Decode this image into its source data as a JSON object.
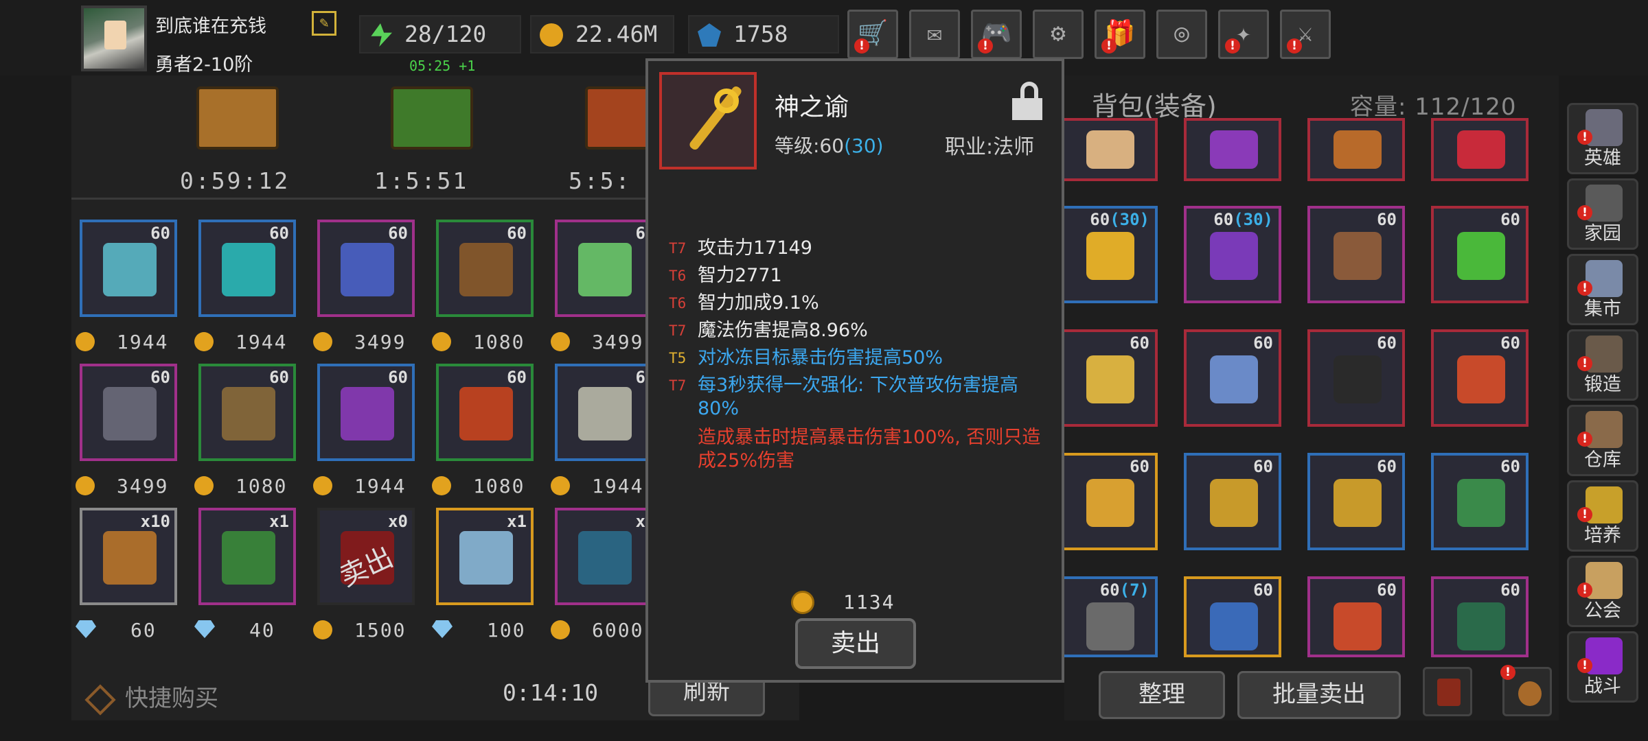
{
  "player": {
    "name": "到底谁在充钱",
    "rank": "勇者2-10阶"
  },
  "resources": {
    "energy": "28/120",
    "energy_timer": "05:25 +1",
    "gold": "22.46M",
    "gems": "1758"
  },
  "top_icons": [
    "shop-cart-icon",
    "mail-icon",
    "gamepad-icon",
    "settings-gear-icon",
    "gift-icon",
    "aperture-wheel-icon",
    "fireworks-icon",
    "crossed-swords-icon"
  ],
  "chests": [
    {
      "time": "0:59:12",
      "color": "#a8702a"
    },
    {
      "time": "1:5:51",
      "color": "#3f7a2a"
    },
    {
      "time": "5:5:",
      "color": "#a4441e"
    }
  ],
  "shop": {
    "row1": [
      {
        "level": "60",
        "price": "1944",
        "border": "#2f6fb8",
        "art": "#5ab8c8"
      },
      {
        "level": "60",
        "price": "1944",
        "border": "#2f6fb8",
        "art": "#2ab8b8"
      },
      {
        "level": "60",
        "price": "3499",
        "border": "#a0308a",
        "art": "#4a62c8"
      },
      {
        "level": "60",
        "price": "1080",
        "border": "#2a8a3a",
        "art": "#8a5a2a"
      },
      {
        "level": "6",
        "price": "3499",
        "border": "#a0308a",
        "art": "#6ac86a"
      }
    ],
    "row2": [
      {
        "level": "60",
        "price": "3499",
        "border": "#a0308a",
        "art": "#6a6a7a"
      },
      {
        "level": "60",
        "price": "1080",
        "border": "#2a8a3a",
        "art": "#8a6a3a"
      },
      {
        "level": "60",
        "price": "1944",
        "border": "#2f6fb8",
        "art": "#8a3ab8"
      },
      {
        "level": "60",
        "price": "1080",
        "border": "#2a8a3a",
        "art": "#c8441e"
      },
      {
        "level": "6",
        "price": "1944",
        "border": "#2f6fb8",
        "art": "#b8b8a8"
      }
    ],
    "row3": [
      {
        "level": "x10",
        "price": "60",
        "border": "#8a8a8a",
        "art": "#b8742a",
        "cur": "gem"
      },
      {
        "level": "x1",
        "price": "40",
        "border": "#a0308a",
        "art": "#3a8a3a",
        "cur": "gem"
      },
      {
        "level": "x0",
        "price": "1500",
        "border": "#2a2a2a",
        "art": "#8a1a1a",
        "cur": "gold",
        "sold": "卖出"
      },
      {
        "level": "x1",
        "price": "100",
        "border": "#d89a1e",
        "art": "#8ab8d8",
        "cur": "gem"
      },
      {
        "level": "x",
        "price": "6000",
        "border": "#a0308a",
        "art": "#2a6a8a",
        "cur": "gold"
      }
    ]
  },
  "left_bottom": {
    "quick_buy": "快捷购买",
    "timer": "0:14:10",
    "refresh": "刷新"
  },
  "bag": {
    "title": "背包(装备)",
    "capacity": "容量: 112/120",
    "sort": "整理",
    "bulk_sell": "批量卖出"
  },
  "bag_rows": [
    [
      {
        "lvl": "",
        "lvl2": "",
        "border": "#a82a3a",
        "art": "#d8b080"
      },
      {
        "lvl": "",
        "lvl2": "",
        "border": "#a82a3a",
        "art": "#8a3ab8"
      },
      {
        "lvl": "",
        "lvl2": "",
        "border": "#a82a3a",
        "art": "#b86a2a"
      },
      {
        "lvl": "",
        "lvl2": "",
        "border": "#a82a3a",
        "art": "#c82a3a"
      }
    ],
    [
      {
        "lvl": "60",
        "lvl2": "(30)",
        "border": "#2f6fb8",
        "art": "#e0ac28"
      },
      {
        "lvl": "60",
        "lvl2": "(30)",
        "border": "#a0308a",
        "art": "#7a3ab8"
      },
      {
        "lvl": "60",
        "lvl2": "",
        "border": "#a0308a",
        "art": "#8a5a3a"
      },
      {
        "lvl": "60",
        "lvl2": "",
        "border": "#a82a3a",
        "art": "#4ab83a"
      }
    ],
    [
      {
        "lvl": "60",
        "lvl2": "",
        "border": "#a82a3a",
        "art": "#d8b040"
      },
      {
        "lvl": "60",
        "lvl2": "",
        "border": "#a82a3a",
        "art": "#6a8ac8"
      },
      {
        "lvl": "60",
        "lvl2": "",
        "border": "#a82a3a",
        "art": "#2a2a2a"
      },
      {
        "lvl": "60",
        "lvl2": "",
        "border": "#a82a3a",
        "art": "#c84a2a"
      }
    ],
    [
      {
        "lvl": "60",
        "lvl2": "",
        "border": "#d89a1e",
        "art": "#d8a030"
      },
      {
        "lvl": "60",
        "lvl2": "",
        "border": "#2f6fb8",
        "art": "#c89a2a"
      },
      {
        "lvl": "60",
        "lvl2": "",
        "border": "#2f6fb8",
        "art": "#c89a2a"
      },
      {
        "lvl": "60",
        "lvl2": "",
        "border": "#2f6fb8",
        "art": "#3a8a4a"
      }
    ],
    [
      {
        "lvl": "60",
        "lvl2": "(7)",
        "border": "#2f6fb8",
        "art": "#6a6a6a"
      },
      {
        "lvl": "60",
        "lvl2": "",
        "border": "#d89a1e",
        "art": "#3a6ab8"
      },
      {
        "lvl": "60",
        "lvl2": "",
        "border": "#a0308a",
        "art": "#c84a2a"
      },
      {
        "lvl": "60",
        "lvl2": "",
        "border": "#a0308a",
        "art": "#2a6a4a"
      }
    ]
  ],
  "side_nav": [
    {
      "label": "英雄",
      "art": "#6a6a7a"
    },
    {
      "label": "家园",
      "art": "#5a5a5a"
    },
    {
      "label": "集市",
      "art": "#7a8aa8"
    },
    {
      "label": "锻造",
      "art": "#6a5a4a"
    },
    {
      "label": "仓库",
      "art": "#8a6a4a"
    },
    {
      "label": "培养",
      "art": "#c8a02a"
    },
    {
      "label": "公会",
      "art": "#c8a060"
    },
    {
      "label": "战斗",
      "art": "#8a2ac8"
    }
  ],
  "tooltip": {
    "name": "神之谕",
    "level_label": "等级:60",
    "level_bonus": "(30)",
    "class": "职业:法师",
    "stats": [
      {
        "tier": "T7",
        "text": "攻击力17149",
        "style": "normal"
      },
      {
        "tier": "T6",
        "text": "智力2771",
        "style": "normal"
      },
      {
        "tier": "T6",
        "text": "智力加成9.1%",
        "style": "normal"
      },
      {
        "tier": "T7",
        "text": "魔法伤害提高8.96%",
        "style": "normal"
      },
      {
        "tier": "T5",
        "text": "对冰冻目标暴击伤害提高50%",
        "style": "blue"
      },
      {
        "tier": "T7",
        "text": "每3秒获得一次强化: 下次普攻伤害提高80%",
        "style": "blue"
      },
      {
        "tier": "",
        "text": "造成暴击时提高暴击伤害100%, 否则只造成25%伤害",
        "style": "red"
      }
    ],
    "price": "1134",
    "sell": "卖出"
  }
}
